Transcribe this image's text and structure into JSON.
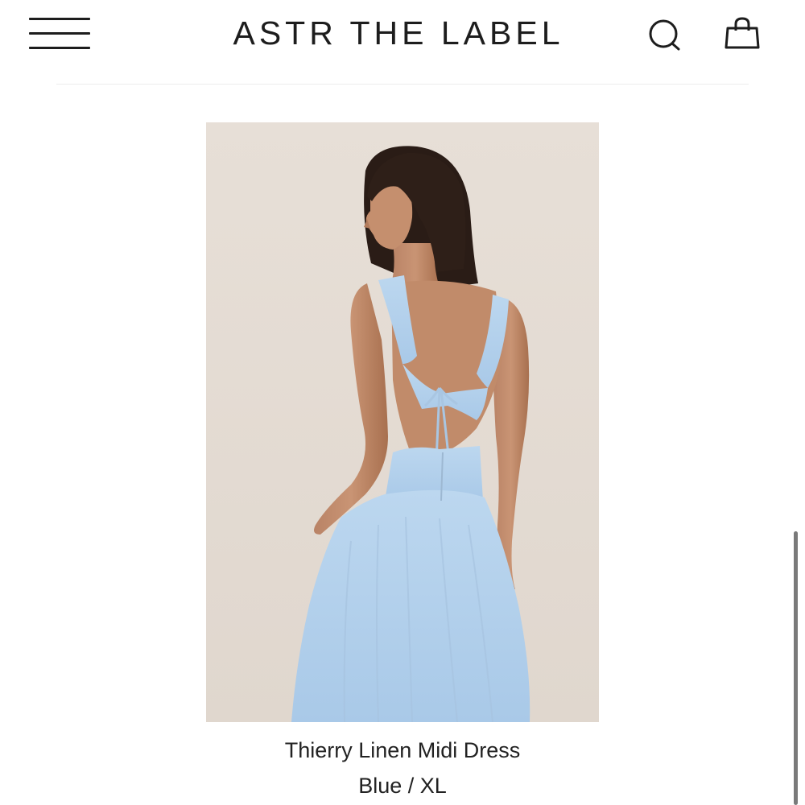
{
  "header": {
    "brand": "ASTR THE LABEL",
    "menu_icon": "hamburger-menu-icon",
    "search_icon": "search-icon",
    "cart_icon": "shopping-bag-icon"
  },
  "product": {
    "title": "Thierry Linen Midi Dress",
    "variant": "Blue / XL",
    "image_alt": "Model wearing light blue open-back linen midi dress"
  },
  "colors": {
    "text": "#1d1d1d",
    "image_background": "#e4dcd4",
    "dress_blue": "#b7d3ec"
  }
}
